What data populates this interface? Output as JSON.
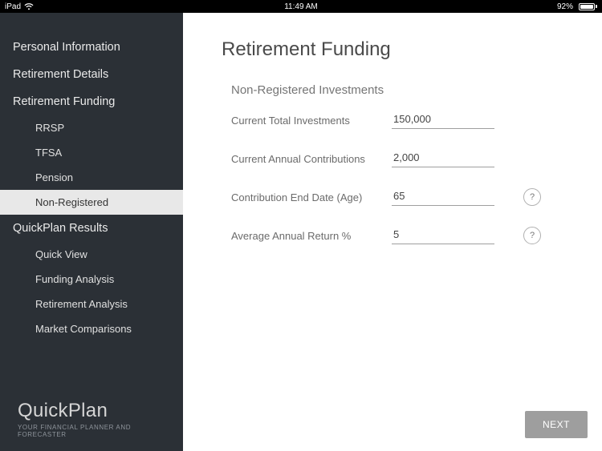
{
  "status": {
    "device": "iPad",
    "time": "11:49 AM",
    "battery_pct": "92%"
  },
  "sidebar": {
    "items": [
      {
        "label": "Personal Information"
      },
      {
        "label": "Retirement Details"
      },
      {
        "label": "Retirement Funding",
        "children": [
          {
            "label": "RRSP"
          },
          {
            "label": "TFSA"
          },
          {
            "label": "Pension"
          },
          {
            "label": "Non-Registered",
            "active": true
          }
        ]
      },
      {
        "label": "QuickPlan Results",
        "children": [
          {
            "label": "Quick View"
          },
          {
            "label": "Funding Analysis"
          },
          {
            "label": "Retirement Analysis"
          },
          {
            "label": "Market Comparisons"
          }
        ]
      }
    ]
  },
  "brand": {
    "name_part1": "Quick",
    "name_part2": "Plan",
    "tagline": "YOUR FINANCIAL PLANNER AND FORECASTER"
  },
  "page": {
    "title": "Retirement Funding",
    "section": "Non-Registered Investments",
    "fields": {
      "current_total": {
        "label": "Current Total Investments",
        "value": "150,000"
      },
      "annual_contrib": {
        "label": "Current Annual Contributions",
        "value": "2,000"
      },
      "contrib_end": {
        "label": "Contribution End Date (Age)",
        "value": "65"
      },
      "avg_return": {
        "label": "Average Annual Return %",
        "value": "5"
      }
    },
    "help_glyph": "?",
    "next_label": "NEXT"
  }
}
